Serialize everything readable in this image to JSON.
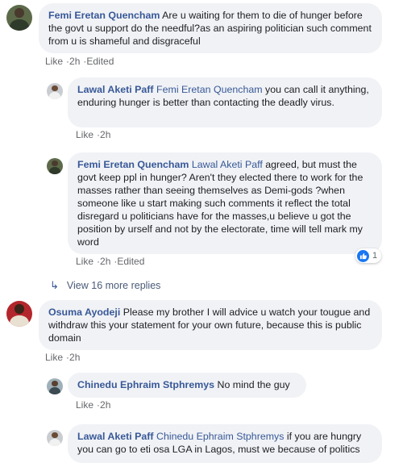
{
  "comments": [
    {
      "name": "Femi Eretan Quencham",
      "text": " Are u waiting for them to die of hunger before the govt u support do the needful?as an aspiring politician such comment from u is shameful and disgraceful",
      "like": "Like",
      "time": "2h",
      "edited": "Edited"
    },
    {
      "name": "Lawal Aketi Paff",
      "mention": "Femi Eretan Quencham",
      "text": " you can call it anything, enduring hunger is better than contacting the deadly virus.",
      "like": "Like",
      "time": "2h"
    },
    {
      "name": "Femi Eretan Quencham",
      "mention": "Lawal Aketi Paff",
      "text": " agreed, but must the govt keep ppl in hunger? Aren't they elected there to work for the masses rather than seeing themselves as Demi-gods ?when someone like u start making such comments it reflect the total disregard u politicians have for the masses,u believe u got the position by urself and not by the electorate, time will tell mark my word",
      "like": "Like",
      "time": "2h",
      "edited": "Edited",
      "reaction_count": "1"
    },
    {
      "name": "Osuma Ayodeji",
      "text": " Please my brother I will advice u watch your tougue and withdraw this your statement for your own future, because this is public domain",
      "like": "Like",
      "time": "2h"
    },
    {
      "name": "Chinedu Ephraim Stphremys",
      "text": " No mind the guy",
      "like": "Like",
      "time": "2h"
    },
    {
      "name": "Lawal Aketi Paff",
      "mention": "Chinedu Ephraim Stphremys",
      "text": " if you are hungry you can go to eti osa LGA in Lagos, must we because of politics"
    }
  ],
  "view_more": "View 16 more replies",
  "separator": "·",
  "colors": {
    "link": "#385898",
    "bubble": "#f0f2f5",
    "meta": "#65676b",
    "like_badge": "#1877f2"
  },
  "icons": [
    "reply-arrow-icon",
    "like-reaction-icon"
  ]
}
